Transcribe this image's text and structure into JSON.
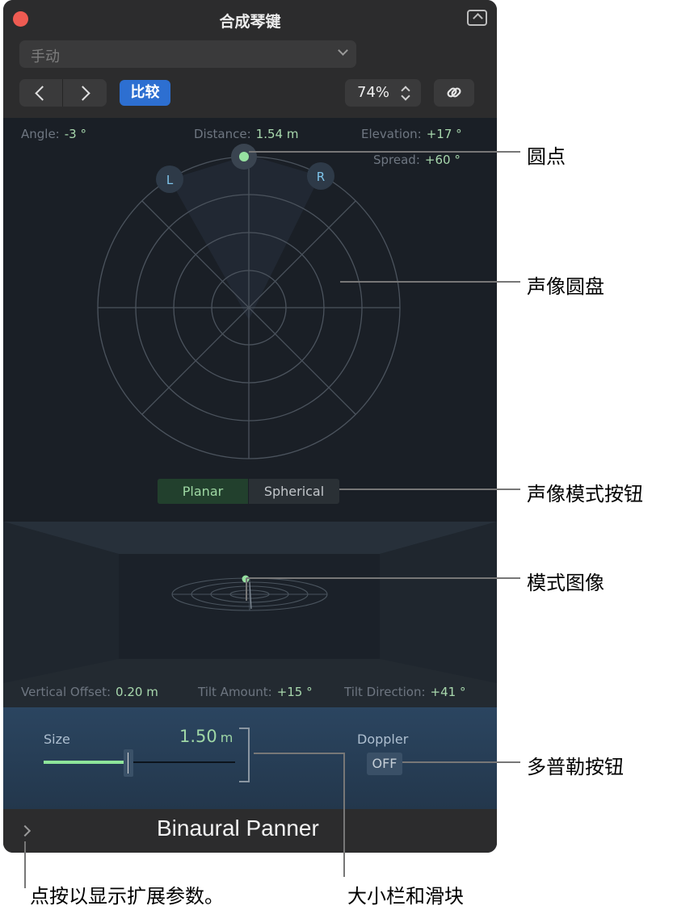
{
  "window": {
    "title": "合成琴键",
    "preset": "手动",
    "compare_label": "比较",
    "zoom": "74%"
  },
  "readouts": {
    "angle_label": "Angle:",
    "angle_value": "-3 °",
    "distance_label": "Distance:",
    "distance_value": "1.54 m",
    "elevation_label": "Elevation:",
    "elevation_value": "+17 °",
    "spread_label": "Spread:",
    "spread_value": "+60 °"
  },
  "pan_disk": {
    "left_label": "L",
    "right_label": "R"
  },
  "pan_mode": {
    "planar_label": "Planar",
    "spherical_label": "Spherical",
    "active": "Planar"
  },
  "bottom_readouts": {
    "vertical_offset_label": "Vertical Offset:",
    "vertical_offset_value": "0.20 m",
    "tilt_amount_label": "Tilt Amount:",
    "tilt_amount_value": "+15 °",
    "tilt_direction_label": "Tilt Direction:",
    "tilt_direction_value": "+41 °"
  },
  "size": {
    "label": "Size",
    "value": "1.50",
    "unit": "m",
    "slider_fraction": 0.44
  },
  "doppler": {
    "label": "Doppler",
    "state": "OFF"
  },
  "footer": {
    "plugin_name": "Binaural Panner"
  },
  "callouts": {
    "dot": "圆点",
    "pan_disk": "声像圆盘",
    "pan_mode_buttons": "声像模式按钮",
    "mode_image": "模式图像",
    "doppler_button": "多普勒按钮",
    "expand_hint": "点按以显示扩展参数。",
    "size_bar_slider": "大小栏和滑块"
  },
  "colors": {
    "accent_green": "#8ee59a",
    "compare_blue": "#2d6fd1",
    "close_red": "#ee5b52"
  }
}
